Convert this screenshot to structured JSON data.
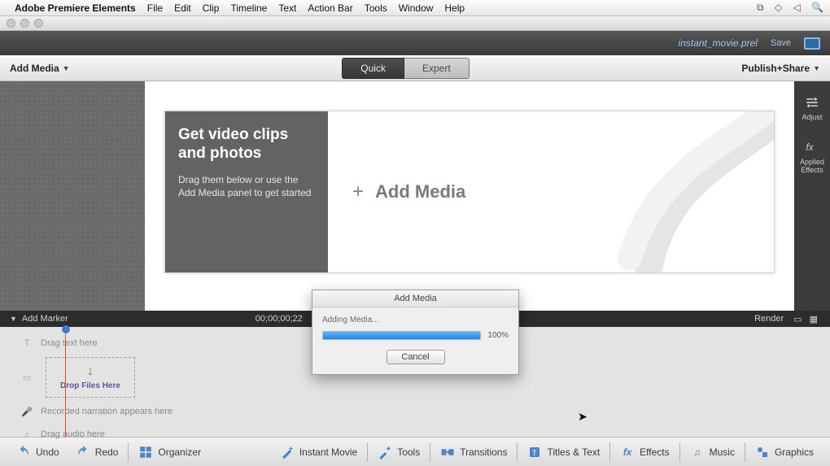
{
  "mac_menu": {
    "app": "Adobe Premiere Elements",
    "items": [
      "File",
      "Edit",
      "Clip",
      "Timeline",
      "Text",
      "Action Bar",
      "Tools",
      "Window",
      "Help"
    ]
  },
  "title_strip": {
    "project": "instant_movie.prel",
    "save": "Save"
  },
  "mode_bar": {
    "add_media": "Add Media",
    "quick": "Quick",
    "expert": "Expert",
    "publish": "Publish+Share"
  },
  "side_tools": {
    "adjust": "Adjust",
    "effects": "Applied\nEffects"
  },
  "promo": {
    "heading": "Get video clips and photos",
    "sub": "Drag them below or use the Add Media panel to get started",
    "cta": "Add Media"
  },
  "timeline": {
    "add_marker": "Add Marker",
    "timecode": "00;00;00;22",
    "render": "Render",
    "drag_text": "Drag text here",
    "drop_label": "Drop Files Here",
    "narration": "Recorded narration appears here",
    "audio": "Drag audio here"
  },
  "action_bar": {
    "undo": "Undo",
    "redo": "Redo",
    "organizer": "Organizer",
    "instant_movie": "Instant Movie",
    "tools": "Tools",
    "transitions": "Transitions",
    "titles": "Titles & Text",
    "effects": "Effects",
    "music": "Music",
    "graphics": "Graphics"
  },
  "modal": {
    "title": "Add Media",
    "message": "Adding Media...",
    "percent_text": "100%",
    "percent_value": 100,
    "cancel": "Cancel"
  }
}
